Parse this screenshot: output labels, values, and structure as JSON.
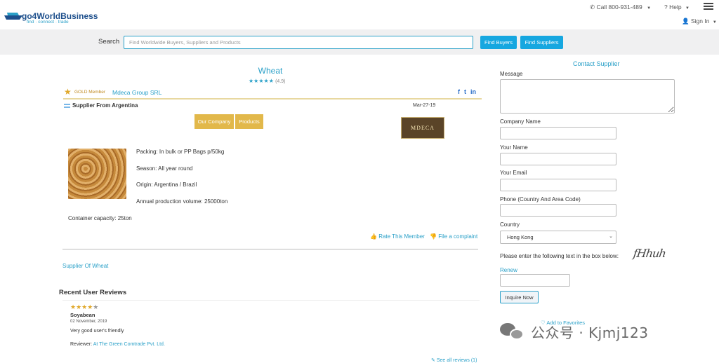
{
  "header": {
    "brand": "go4WorldBusiness",
    "tagline": "find · connect · trade",
    "call": "Call 800-931-489",
    "help": "Help",
    "signin": "Sign In"
  },
  "search": {
    "label": "Search",
    "placeholder": "Find Worldwide Buyers, Suppliers and Products",
    "find_buyers": "Find Buyers",
    "find_suppliers": "Find Suppliers"
  },
  "product": {
    "title": "Wheat",
    "stars": "★★★★★",
    "rating": "(4.9)",
    "member_level": "GOLD Member",
    "company": "Mdeca Group SRL",
    "supplier_from": "Supplier From Argentina",
    "date": "Mar-27-19",
    "our_company": "Our Company",
    "products": "Products",
    "company_logo_text": "MDECA",
    "specs": [
      "Packing: In bulk or PP Bags p/50kg",
      "Season: All year round",
      "Origin: Argentina / Brazil",
      "Annual production volume: 25000ton"
    ],
    "capacity": "Container capacity: 25ton",
    "rate": "Rate This Member",
    "complaint": "File a complaint",
    "supplier_of": "Supplier Of Wheat"
  },
  "reviews": {
    "title": "Recent User Reviews",
    "items": [
      {
        "stars_on": "★★★★",
        "stars_off": "★",
        "product": "Soyabean",
        "date": "02 November, 2019",
        "text": "Very good user's friendly",
        "reviewer_label": "Reviewer:",
        "reviewer": "At The Green Comtrade Pvt. Ltd."
      }
    ],
    "see_all": "See all reviews (1)"
  },
  "contact": {
    "title": "Contact Supplier",
    "message_label": "Message",
    "company_label": "Company Name",
    "name_label": "Your Name",
    "email_label": "Your Email",
    "phone_label": "Phone (Country And Area Code)",
    "country_label": "Country",
    "country_value": "Hong Kong",
    "captcha_prompt": "Please enter the following text in the box below:",
    "captcha_text": "fHhuh",
    "renew": "Renew",
    "inquire": "Inquire Now",
    "favorites": "Add to Favorites"
  },
  "watermark": {
    "text": "公众号 · Kjmj123"
  }
}
